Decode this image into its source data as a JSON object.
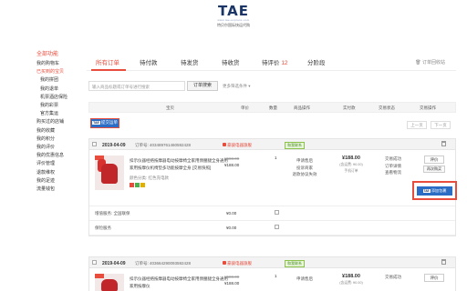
{
  "header": {
    "logo_text": "TAE",
    "logo_url": "www.tae-express.com",
    "logo_sub": "特贝尔国际快运代购"
  },
  "sidebar": {
    "title": "全部功能",
    "items": [
      {
        "label": "我的购物车",
        "active": false,
        "sub": false
      },
      {
        "label": "已买到的宝贝",
        "active": true,
        "sub": false
      },
      {
        "label": "我的拼团",
        "active": false,
        "sub": true
      },
      {
        "label": "我的退单",
        "active": false,
        "sub": true
      },
      {
        "label": "机票酒店保险",
        "active": false,
        "sub": true
      },
      {
        "label": "我的彩票",
        "active": false,
        "sub": true
      },
      {
        "label": "官方集运",
        "active": false,
        "sub": true
      },
      {
        "label": "购买过的店铺",
        "active": false,
        "sub": false
      },
      {
        "label": "我的收藏",
        "active": false,
        "sub": false
      },
      {
        "label": "我的积分",
        "active": false,
        "sub": false
      },
      {
        "label": "我的评价",
        "active": false,
        "sub": false
      },
      {
        "label": "我的优惠信息",
        "active": false,
        "sub": false
      },
      {
        "label": "评价管理",
        "active": false,
        "sub": false
      },
      {
        "label": "退款维权",
        "active": false,
        "sub": false
      },
      {
        "label": "我的足迹",
        "active": false,
        "sub": false
      },
      {
        "label": "流量钱包",
        "active": false,
        "sub": false
      }
    ]
  },
  "tabs": [
    {
      "label": "所有订单",
      "count": ""
    },
    {
      "label": "待付款",
      "count": ""
    },
    {
      "label": "待发货",
      "count": ""
    },
    {
      "label": "待收货",
      "count": ""
    },
    {
      "label": "待评价",
      "count": "12"
    },
    {
      "label": "分阶段",
      "count": ""
    }
  ],
  "recycle_label": "订单回收站",
  "search": {
    "placeholder": "输入商品标题或订单号进行搜索",
    "button_label": "订单搜索",
    "more_label": "更多筛选条件"
  },
  "columns": [
    "宝贝",
    "单价",
    "数量",
    "商品操作",
    "实付款",
    "交易状态",
    "交易操作"
  ],
  "merge_button": {
    "tag": "TAE",
    "label": "提交运单"
  },
  "pager": {
    "prev": "上一页",
    "next": "下一页"
  },
  "orders": [
    {
      "date": "2019-04-09",
      "order_no_label": "订单号: 403489761460592428",
      "shop": "豪骏电器旗舰",
      "contact": "和我联系",
      "item_title": "扣示仪器经络按摩器电动按摩椅全家用颈腰腿全身通用家用按摩仪机椅垫多功能按摩全身 [交易快照]",
      "props": "颜色分类: 红色充电款",
      "price_old": "¥588.00",
      "price_new": "¥188.00",
      "qty": "1",
      "ops": [
        "申请售后",
        "投诉商家",
        "退款协议失效"
      ],
      "paid_amount": "¥188.00",
      "paid_sub": "(含运费: ¥0.00)",
      "paid_link": "手机订单",
      "status": [
        "交易成功",
        "订单详情",
        "查看物流"
      ],
      "eval_label": "评价",
      "buyagain_label": "再次购买",
      "add_pkg": {
        "tag": "TAE",
        "label": "添加包裹"
      },
      "services": [
        {
          "name": "增值服务: 全国联保",
          "value": "¥0.00"
        },
        {
          "name": "保险服务",
          "value": "¥0.00"
        }
      ]
    },
    {
      "date": "2019-04-09",
      "order_no_label": "订单号: 403664290093592428",
      "shop": "豪骏电器旗舰",
      "contact": "和我联系",
      "item_title": "扣示仪器经络按摩器电动按摩椅全家用颈腰腿全身通用家用按摩仪",
      "price_old": "¥588.00",
      "price_new": "¥188.00",
      "qty": "1",
      "ops": [
        "申请售后"
      ],
      "paid_amount": "¥188.00",
      "paid_sub": "(含运费: ¥0.00)",
      "status": [
        "交易成功"
      ],
      "eval_label": "评价"
    }
  ]
}
